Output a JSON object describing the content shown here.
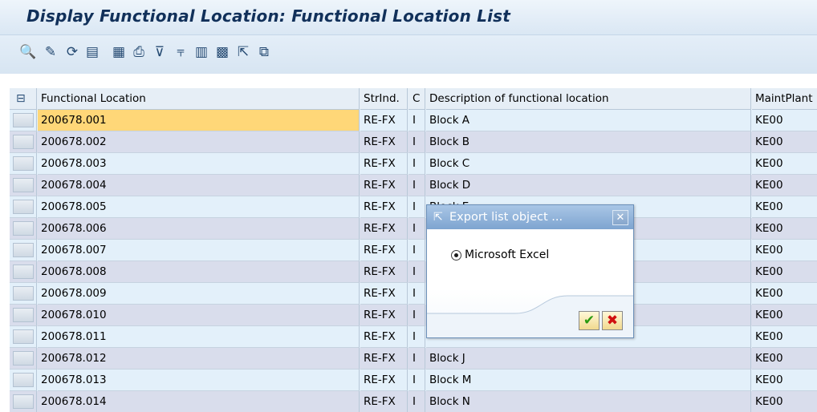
{
  "window": {
    "title": "Display Functional Location: Functional Location List"
  },
  "toolbar": {
    "icons": [
      {
        "name": "details-icon",
        "glyph": "🔍"
      },
      {
        "name": "select-icon",
        "glyph": "✎"
      },
      {
        "name": "refresh-icon",
        "glyph": "⟳"
      },
      {
        "name": "layout-icon",
        "glyph": "▤"
      },
      {
        "name": "choose-layout-icon",
        "glyph": "▦"
      },
      {
        "name": "print-icon",
        "glyph": "⎙"
      },
      {
        "name": "sort-icon",
        "glyph": "⊽"
      },
      {
        "name": "filter-icon",
        "glyph": "⫧"
      },
      {
        "name": "graphic-icon",
        "glyph": "▥"
      },
      {
        "name": "calculator-icon",
        "glyph": "▩"
      },
      {
        "name": "export-icon",
        "glyph": "⇱"
      },
      {
        "name": "copy-icon",
        "glyph": "⧉"
      }
    ]
  },
  "table": {
    "header_icon": "⊟",
    "columns": {
      "functional_location": "Functional Location",
      "structure_indicator": "StrInd.",
      "category": "C",
      "description": "Description of functional location",
      "maint_plant": "MaintPlant"
    },
    "rows": [
      {
        "fl": "200678.001",
        "str": "RE-FX",
        "c": "I",
        "desc": "Block A",
        "mp": "KE00"
      },
      {
        "fl": "200678.002",
        "str": "RE-FX",
        "c": "I",
        "desc": "Block B",
        "mp": "KE00"
      },
      {
        "fl": "200678.003",
        "str": "RE-FX",
        "c": "I",
        "desc": "Block C",
        "mp": "KE00"
      },
      {
        "fl": "200678.004",
        "str": "RE-FX",
        "c": "I",
        "desc": "Block D",
        "mp": "KE00"
      },
      {
        "fl": "200678.005",
        "str": "RE-FX",
        "c": "I",
        "desc": "Block E",
        "mp": "KE00"
      },
      {
        "fl": "200678.006",
        "str": "RE-FX",
        "c": "I",
        "desc": "",
        "mp": "KE00"
      },
      {
        "fl": "200678.007",
        "str": "RE-FX",
        "c": "I",
        "desc": "",
        "mp": "KE00"
      },
      {
        "fl": "200678.008",
        "str": "RE-FX",
        "c": "I",
        "desc": "",
        "mp": "KE00"
      },
      {
        "fl": "200678.009",
        "str": "RE-FX",
        "c": "I",
        "desc": "",
        "mp": "KE00"
      },
      {
        "fl": "200678.010",
        "str": "RE-FX",
        "c": "I",
        "desc": "",
        "mp": "KE00"
      },
      {
        "fl": "200678.011",
        "str": "RE-FX",
        "c": "I",
        "desc": "",
        "mp": "KE00"
      },
      {
        "fl": "200678.012",
        "str": "RE-FX",
        "c": "I",
        "desc": "Block J",
        "mp": "KE00"
      },
      {
        "fl": "200678.013",
        "str": "RE-FX",
        "c": "I",
        "desc": "Block M",
        "mp": "KE00"
      },
      {
        "fl": "200678.014",
        "str": "RE-FX",
        "c": "I",
        "desc": "Block N",
        "mp": "KE00"
      }
    ]
  },
  "dialog": {
    "title": "Export list object ...",
    "title_icon": "⇱",
    "close_glyph": "✕",
    "option_label": "Microsoft Excel",
    "ok_glyph": "✔",
    "cancel_glyph": "✖"
  },
  "colors": {
    "row_odd": "#e3f0fa",
    "row_even": "#d9ddec",
    "active_cell": "#ffd778",
    "dialog_title": "#7ea4d0"
  }
}
